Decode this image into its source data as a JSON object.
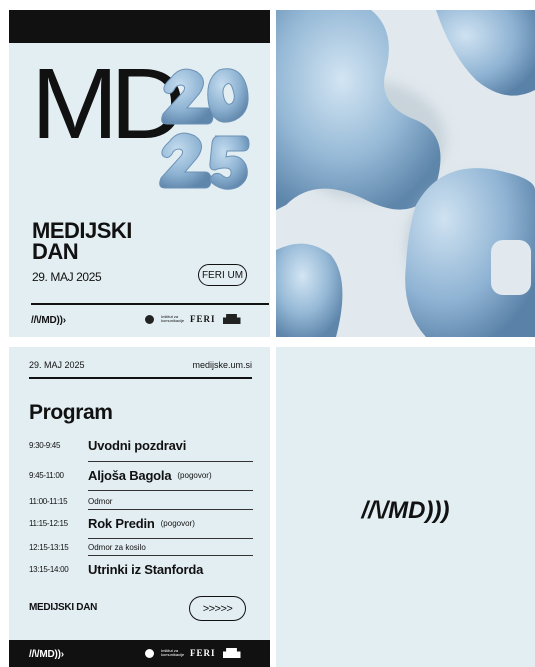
{
  "colors": {
    "panel_bg": "#e3eef3",
    "ink": "#111111",
    "blob_blue": "#8fb3d1"
  },
  "poster": {
    "logo_text": "MD",
    "year_digits": [
      "20",
      "25"
    ],
    "title_line1": "MEDIJSKI",
    "title_line2": "DAN",
    "date": "29. MAJ 2025",
    "badge": "FERI UM",
    "brand_mark": "//\\/MD))›",
    "partner_tiny": "Inštitut za komunikacije",
    "partner_feri": "FERI"
  },
  "program": {
    "date": "29. MAJ 2025",
    "site": "medijske.um.si",
    "title": "Program",
    "rows": [
      {
        "time": "9:30-9:45",
        "label": "Uvodni pozdravi",
        "note": "",
        "big": true
      },
      {
        "time": "9:45-11:00",
        "label": "Aljoša Bagola",
        "note": "(pogovor)",
        "big": true
      },
      {
        "time": "11:00-11:15",
        "label": "Odmor",
        "note": "",
        "big": false
      },
      {
        "time": "11:15-12:15",
        "label": "Rok Predin",
        "note": "(pogovor)",
        "big": true
      },
      {
        "time": "12:15-13:15",
        "label": "Odmor za kosilo",
        "note": "",
        "big": false
      },
      {
        "time": "13:15-14:00",
        "label": "Utrinki iz Stanforda",
        "note": "",
        "big": true
      }
    ],
    "footer_title": "MEDIJSKI DAN",
    "arrow_button": ">>>>>",
    "brand_mark": "//\\/MD))›",
    "partner_tiny": "Inštitut za komunikacije",
    "partner_feri": "FERI"
  },
  "logo_panel": {
    "brand_mark": "//\\/MD)))"
  }
}
